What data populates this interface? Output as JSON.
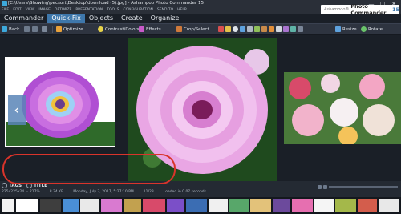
{
  "titlebar": {
    "path": "[C:\\Users\\Showing\\pecsort\\Desktop\\download (5).jpg] - Ashampoo Photo Commander 15",
    "min": "—",
    "max": "☐",
    "close": "✕"
  },
  "menu": [
    "FILE",
    "EDIT",
    "VIEW",
    "IMAGE",
    "OPTIMIZE",
    "PRESENTATION",
    "TOOLS",
    "CONFIGURATION",
    "SEND TO",
    "HELP"
  ],
  "brand": {
    "line1": "Ashampoo®",
    "line2": "Photo Commander"
  },
  "brand_version": "15",
  "nav_tabs": [
    "Commander",
    "Quick-Fix",
    "Objects",
    "Create",
    "Organize"
  ],
  "nav_active": "Quick-Fix",
  "toolbar": {
    "back": "Back",
    "optimize": "Optimize",
    "contrast": "Contrast/Colors",
    "effects": "Effects",
    "crop": "Crop/Select",
    "resize": "Resize",
    "rotate": "Rotate"
  },
  "tags_bar": {
    "tags": "TAGS",
    "title": "TITLE"
  },
  "status": {
    "dimensions": "225x225x24 = 217%",
    "filesize": "8.34 KB",
    "date": "Monday, July 3, 2017, 5:27:10 PM",
    "index": "11/23",
    "loaded": "Loaded in 0.07 seconds"
  },
  "icons": [
    "back-arrow-icon",
    "undo-icon",
    "redo-icon",
    "save-icon",
    "optimize-icon",
    "contrast-icon",
    "effects-icon",
    "crop-icon",
    "palette-icon",
    "settings-icon",
    "zoom-icon",
    "resize-icon",
    "rotate-icon",
    "nav-left-icon"
  ],
  "colors": {
    "accent": "#3e77ab",
    "annotation": "#d9342b",
    "background": "#1a1f27"
  }
}
